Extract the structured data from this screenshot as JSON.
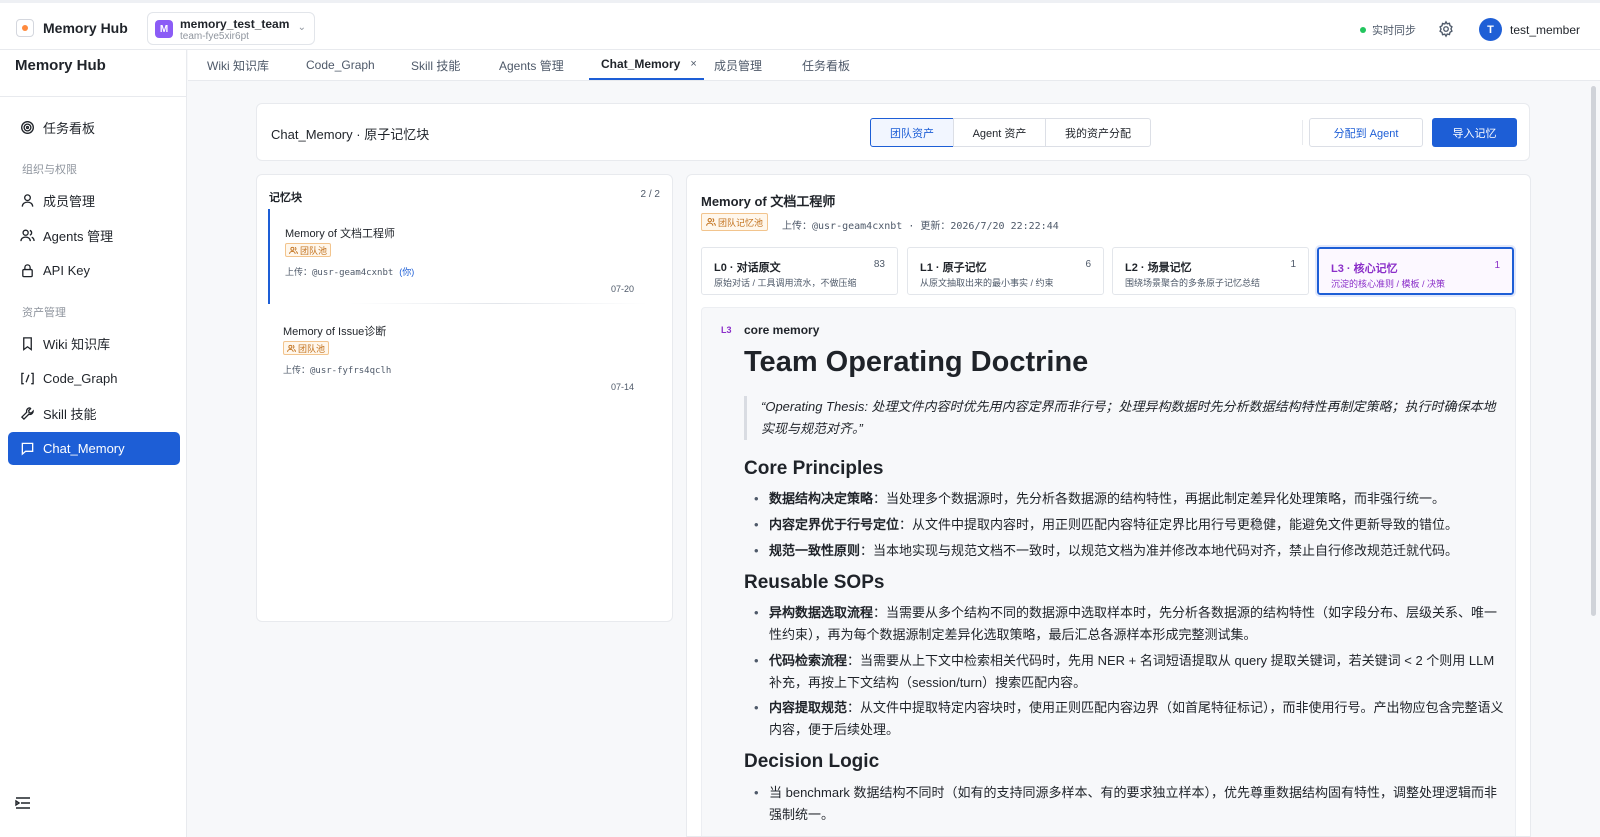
{
  "topbar": {
    "app_title": "Memory Hub",
    "team_initial": "M",
    "team_name": "memory_test_team",
    "team_id": "team-fye5xir6pt",
    "sync_label": "实时同步",
    "user_initial": "T",
    "user_name": "test_member",
    "accent": "#1d5ed6"
  },
  "sidebar": {
    "title": "Memory Hub",
    "top_item": {
      "label": "任务看板",
      "icon": "target-icon"
    },
    "group_org": "组织与权限",
    "org_items": [
      {
        "label": "成员管理",
        "icon": "user-icon"
      },
      {
        "label": "Agents 管理",
        "icon": "users-icon"
      },
      {
        "label": "API Key",
        "icon": "lock-icon"
      }
    ],
    "group_assets": "资产管理",
    "asset_items": [
      {
        "label": "Wiki 知识库",
        "icon": "bookmark-icon"
      },
      {
        "label": "Code_Graph",
        "icon": "code-icon"
      },
      {
        "label": "Skill 技能",
        "icon": "tool-icon"
      },
      {
        "label": "Chat_Memory",
        "icon": "chat-icon",
        "active": true
      }
    ]
  },
  "tabs": [
    {
      "label": "Wiki 知识库"
    },
    {
      "label": "Code_Graph"
    },
    {
      "label": "Skill 技能"
    },
    {
      "label": "Agents 管理"
    },
    {
      "label": "Chat_Memory",
      "active": true,
      "close": "×"
    },
    {
      "label": "成员管理"
    },
    {
      "label": "任务看板"
    }
  ],
  "header": {
    "title": "Chat_Memory · 原子记忆块",
    "segments": [
      {
        "label": "团队资产",
        "active": true
      },
      {
        "label": "Agent 资产"
      },
      {
        "label": "我的资产分配"
      }
    ],
    "assign_button": "分配到 Agent",
    "import_button": "导入记忆"
  },
  "memory_list": {
    "title": "记忆块",
    "count": "2 / 2",
    "items": [
      {
        "name": "Memory of 文档工程师",
        "tag": "团队池",
        "uploader": "上传：@usr-geam4cxnbt",
        "you": "(你)",
        "date": "07-20",
        "active": true
      },
      {
        "name": "Memory of Issue诊断",
        "tag": "团队池",
        "uploader": "上传：@usr-fyfrs4qclh",
        "you": "",
        "date": "07-14"
      }
    ]
  },
  "detail": {
    "title": "Memory of 文档工程师",
    "tag": "团队记忆池",
    "meta": "上传：@usr-geam4cxnbt  ·  更新：2026/7/20 22:22:44",
    "levels": [
      {
        "name": "L0 · 对话原文",
        "count": "83",
        "desc": "原始对话 / 工具调用流水，不做压缩"
      },
      {
        "name": "L1 · 原子记忆",
        "count": "6",
        "desc": "从原文抽取出来的最小事实 / 约束"
      },
      {
        "name": "L2 · 场景记忆",
        "count": "1",
        "desc": "围绕场景聚合的多条原子记忆总结"
      },
      {
        "name": "L3 · 核心记忆",
        "count": "1",
        "desc": "沉淀的核心准则 / 模板 / 决策",
        "active": true
      }
    ],
    "content": {
      "badge": "L3",
      "kind": "core memory",
      "h1": "Team Operating Doctrine",
      "quote": "“Operating Thesis: 处理文件内容时优先用内容定界而非行号；处理异构数据时先分析数据结构特性再制定策略；执行时确保本地实现与规范对齐。”",
      "core_title": "Core Principles",
      "core": [
        {
          "b": "数据结构决定策略",
          "t": "：当处理多个数据源时，先分析各数据源的结构特性，再据此制定差异化处理策略，而非强行统一。"
        },
        {
          "b": "内容定界优于行号定位",
          "t": "：从文件中提取内容时，用正则匹配内容特征定界比用行号更稳健，能避免文件更新导致的错位。"
        },
        {
          "b": "规范一致性原则",
          "t": "：当本地实现与规范文档不一致时，以规范文档为准并修改本地代码对齐，禁止自行修改规范迁就代码。"
        }
      ],
      "sop_title": "Reusable SOPs",
      "sops": [
        {
          "b": "异构数据选取流程",
          "t": "：当需要从多个结构不同的数据源中选取样本时，先分析各数据源的结构特性（如字段分布、层级关系、唯一性约束），再为每个数据源制定差异化选取策略，最后汇总各源样本形成完整测试集。"
        },
        {
          "b": "代码检索流程",
          "t": "：当需要从上下文中检索相关代码时，先用 NER + 名词短语提取从 query 提取关键词，若关键词 < 2 个则用 LLM 补充，再按上下文结构（session/turn）搜索匹配内容。"
        },
        {
          "b": "内容提取规范",
          "t": "：从文件中提取特定内容块时，使用正则匹配内容边界（如首尾特征标记），而非使用行号。产出物应包含完整语义内容，便于后续处理。"
        }
      ],
      "decision_title": "Decision Logic",
      "decisions": [
        {
          "b": "",
          "t": "当 benchmark 数据结构不同时（如有的支持同源多样本、有的要求独立样本），优先尊重数据结构固有特性，调整处理逻辑而非强制统一。"
        }
      ]
    }
  }
}
